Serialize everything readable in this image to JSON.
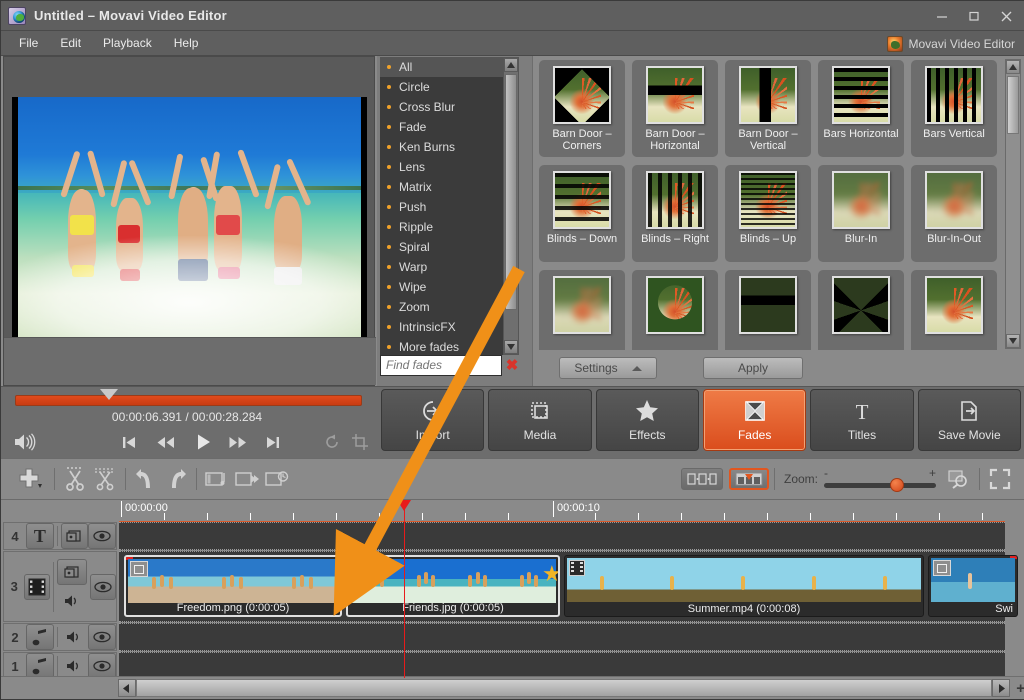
{
  "window": {
    "title": "Untitled – Movavi Video Editor",
    "app_icon": "movavi-app-icon",
    "minimize": "−",
    "maximize": "□",
    "close": "✕"
  },
  "menubar": {
    "items": [
      "File",
      "Edit",
      "Playback",
      "Help"
    ],
    "brand": "Movavi Video Editor",
    "brand_logo": "movavi-logo-icon"
  },
  "categories": {
    "items": [
      "All",
      "Circle",
      "Cross Blur",
      "Fade",
      "Ken Burns",
      "Lens",
      "Matrix",
      "Push",
      "Ripple",
      "Spiral",
      "Warp",
      "Wipe",
      "Zoom",
      "IntrinsicFX",
      "More fades"
    ],
    "selected": "All"
  },
  "search": {
    "placeholder": "Find fades",
    "value": "",
    "clear_icon": "clear-x-icon"
  },
  "fades": {
    "items": [
      {
        "label": "Barn Door – Corners",
        "art": "ov-barn-corners",
        "base": "art"
      },
      {
        "label": "Barn Door – Horizontal",
        "art": "ov-barn-h",
        "base": "art"
      },
      {
        "label": "Barn Door – Vertical",
        "art": "ov-barn-v",
        "base": "art"
      },
      {
        "label": "Bars Horizontal",
        "art": "ov-bars-h",
        "base": "art"
      },
      {
        "label": "Bars Vertical",
        "art": "ov-bars-v",
        "base": "art"
      },
      {
        "label": "Blinds – Down",
        "art": "ov-blinds-d",
        "base": "art"
      },
      {
        "label": "Blinds – Right",
        "art": "ov-blinds-r",
        "base": "art"
      },
      {
        "label": "Blinds – Up",
        "art": "ov-blinds-u",
        "base": "art"
      },
      {
        "label": "Blur-In",
        "art": "ov-blur",
        "base": "art"
      },
      {
        "label": "Blur-In-Out",
        "art": "ov-blur",
        "base": "art"
      },
      {
        "label": "",
        "art": "ov-blur",
        "base": "art"
      },
      {
        "label": "",
        "art": "ov-circle",
        "base": "art"
      },
      {
        "label": "",
        "art": "ov-barn-h",
        "base": "art-sun"
      },
      {
        "label": "",
        "art": "ov-cross",
        "base": "art-sun"
      },
      {
        "label": "",
        "art": "",
        "base": "art"
      }
    ],
    "settings_label": "Settings",
    "apply_label": "Apply"
  },
  "player": {
    "current_time": "00:00:06.391",
    "separator": "/",
    "total_time": "00:00:28.284",
    "volume_icon": "volume-icon",
    "start_icon": "skip-to-start-icon",
    "rewind_icon": "rewind-icon",
    "play_icon": "play-icon",
    "forward_icon": "fast-forward-icon",
    "end_icon": "skip-to-end-icon",
    "rotate_icon": "rotate-icon",
    "crop_icon": "crop-icon"
  },
  "tabs": [
    {
      "label": "Import",
      "icon": "import-icon",
      "active": false
    },
    {
      "label": "Media",
      "icon": "media-icon",
      "active": false
    },
    {
      "label": "Effects",
      "icon": "star-icon",
      "active": false
    },
    {
      "label": "Fades",
      "icon": "fades-icon",
      "active": true
    },
    {
      "label": "Titles",
      "icon": "titles-t-icon",
      "active": false
    },
    {
      "label": "Save Movie",
      "icon": "save-movie-icon",
      "active": false
    }
  ],
  "timeline_toolbar": {
    "add_label": "",
    "icons": [
      "add-files-icon",
      "cut-icon",
      "split-scenes-icon",
      "undo-icon",
      "redo-icon",
      "audio-properties-icon",
      "transition-properties-icon",
      "clip-duration-icon"
    ],
    "storyboard_icon": "storyboard-view-icon",
    "timeline_icon": "timeline-view-icon",
    "zoom_label": "Zoom:",
    "zoom_minus": "-",
    "zoom_plus": "+",
    "zoom_value": 60,
    "fit_icon": "zoom-to-fit-icon",
    "fullscreen_icon": "fullscreen-icon"
  },
  "timeline": {
    "ruler_labels": [
      "00:00:00",
      "00:00:10"
    ],
    "playhead_time": "00:00:06.391",
    "tracks": [
      {
        "number": "4",
        "type": "titles",
        "type_icon": "titles-t-icon",
        "controls": [
          "mask-icon",
          "eye-icon"
        ]
      },
      {
        "number": "3",
        "type": "video",
        "type_icon": "film-icon",
        "controls": [
          "mask-icon",
          "eye-icon",
          "speaker-icon"
        ]
      },
      {
        "number": "2",
        "type": "audio",
        "type_icon": "music-note-icon",
        "controls": [
          "speaker-icon",
          "eye-icon"
        ]
      },
      {
        "number": "1",
        "type": "audio",
        "type_icon": "music-note-icon",
        "controls": [
          "speaker-icon",
          "eye-icon"
        ]
      }
    ],
    "clips": [
      {
        "name": "Freedom.png (0:00:05)",
        "kind": "image",
        "selected": true
      },
      {
        "name": "Friends.jpg (0:00:05)",
        "kind": "image",
        "selected": true,
        "has_star": true
      },
      {
        "name": "Summer.mp4 (0:00:08)",
        "kind": "video",
        "selected": false
      },
      {
        "name": "Swi",
        "kind": "image",
        "selected": false
      }
    ]
  },
  "annotation": {
    "arrow_color": "#f09018",
    "from": "fades-panel",
    "to": "timeline-clip-junction"
  },
  "colors": {
    "accent": "#e2561f",
    "window_bg": "#8a8a8a",
    "panel_dark": "#3b3b3b",
    "title_bar": "#5f5f5f",
    "playhead": "#e81b1b"
  }
}
